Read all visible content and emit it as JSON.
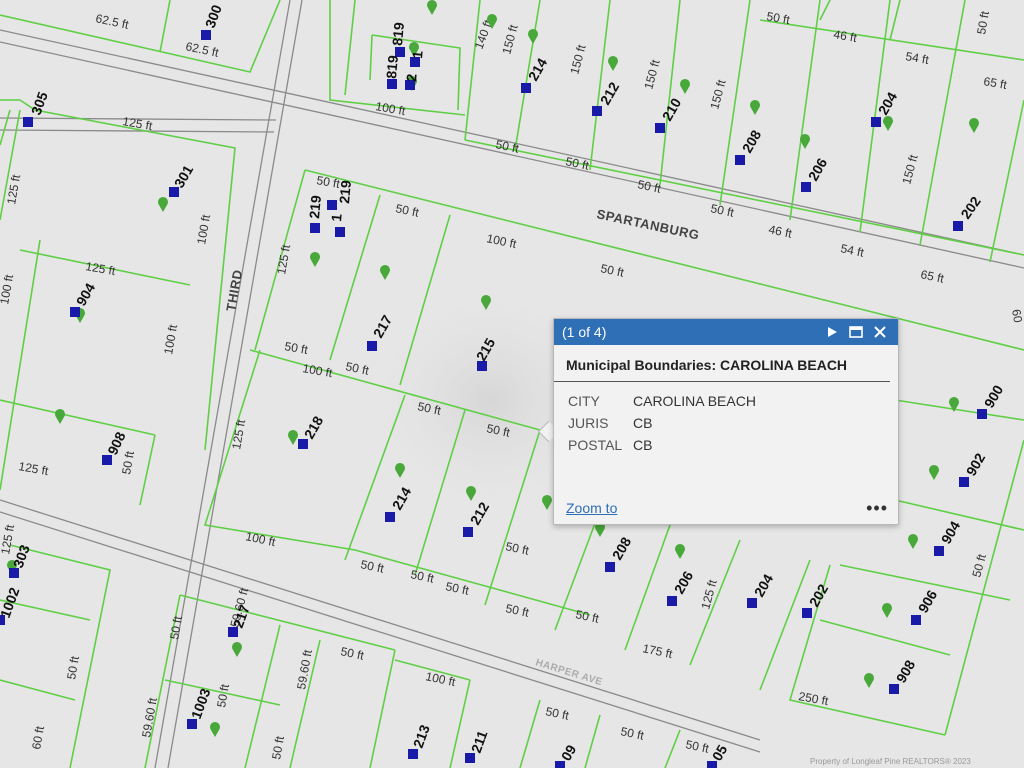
{
  "map": {
    "streets": {
      "third": "THIRD",
      "spartanburg": "SPARTANBURG",
      "bottom": "HARPER AVE"
    },
    "lot_labels": [
      {
        "t": "62.5 ft"
      },
      {
        "t": "62.5 ft"
      },
      {
        "t": "140 ft"
      },
      {
        "t": "150 ft"
      },
      {
        "t": "150 ft"
      },
      {
        "t": "150 ft"
      },
      {
        "t": "150 ft"
      },
      {
        "t": "50 ft"
      },
      {
        "t": "46 ft"
      },
      {
        "t": "54 ft"
      },
      {
        "t": "65 ft"
      },
      {
        "t": "50 ft"
      },
      {
        "t": "100 ft"
      },
      {
        "t": "50 ft"
      },
      {
        "t": "50 ft"
      },
      {
        "t": "50 ft"
      },
      {
        "t": "50 ft"
      },
      {
        "t": "46 ft"
      },
      {
        "t": "54 ft"
      },
      {
        "t": "65 ft"
      },
      {
        "t": "150 ft"
      },
      {
        "t": "125 ft"
      },
      {
        "t": "125 ft"
      },
      {
        "t": "100 ft"
      },
      {
        "t": "125 ft"
      },
      {
        "t": "100 ft"
      },
      {
        "t": "100 ft"
      },
      {
        "t": "125 ft"
      },
      {
        "t": "50 ft"
      },
      {
        "t": "125 ft"
      },
      {
        "t": "50 ft"
      },
      {
        "t": "100 ft"
      },
      {
        "t": "50 ft"
      },
      {
        "t": "50 ft"
      },
      {
        "t": "100 ft"
      },
      {
        "t": "50 ft"
      },
      {
        "t": "50 ft"
      },
      {
        "t": "50 ft"
      },
      {
        "t": "50 ft"
      },
      {
        "t": "50 ft"
      },
      {
        "t": "125 ft"
      },
      {
        "t": "125 ft"
      },
      {
        "t": "100 ft"
      },
      {
        "t": "50 ft"
      },
      {
        "t": "50 ft"
      },
      {
        "t": "50 ft"
      },
      {
        "t": "125 ft"
      },
      {
        "t": "50 ft"
      },
      {
        "t": "50 ft"
      },
      {
        "t": "250 ft"
      },
      {
        "t": "175 ft"
      },
      {
        "t": "50 ft"
      },
      {
        "t": "50 ft"
      },
      {
        "t": "59.60 ft"
      },
      {
        "t": "59.60 ft"
      },
      {
        "t": "59.60 ft"
      },
      {
        "t": "50 ft"
      },
      {
        "t": "100 ft"
      },
      {
        "t": "50 ft"
      },
      {
        "t": "50 ft"
      },
      {
        "t": "50 ft"
      },
      {
        "t": "50 ft"
      },
      {
        "t": "60 ft"
      },
      {
        "t": "50 ft"
      },
      {
        "t": "50 ft"
      },
      {
        "t": "60"
      }
    ],
    "addresses": [
      {
        "t": "300"
      },
      {
        "t": "305"
      },
      {
        "t": "301"
      },
      {
        "t": "904"
      },
      {
        "t": "908"
      },
      {
        "t": "303"
      },
      {
        "t": "1002"
      },
      {
        "t": "1003"
      },
      {
        "t": "217"
      },
      {
        "t": "213"
      },
      {
        "t": "211"
      },
      {
        "t": "819"
      },
      {
        "t": "819"
      },
      {
        "t": "1"
      },
      {
        "t": "2"
      },
      {
        "t": "214"
      },
      {
        "t": "212"
      },
      {
        "t": "210"
      },
      {
        "t": "208"
      },
      {
        "t": "206"
      },
      {
        "t": "204"
      },
      {
        "t": "202"
      },
      {
        "t": "219"
      },
      {
        "t": "219"
      },
      {
        "t": "1"
      },
      {
        "t": "217"
      },
      {
        "t": "215"
      },
      {
        "t": "218"
      },
      {
        "t": "214"
      },
      {
        "t": "212"
      },
      {
        "t": "208"
      },
      {
        "t": "206"
      },
      {
        "t": "204"
      },
      {
        "t": "202"
      },
      {
        "t": "900"
      },
      {
        "t": "902"
      },
      {
        "t": "904"
      },
      {
        "t": "906"
      },
      {
        "t": "908"
      },
      {
        "t": "09"
      },
      {
        "t": "05"
      }
    ],
    "watermark": "Property of Longleaf Pine REALTORS® 2023",
    "colors": {
      "background": "#e6e6e6",
      "parcel_line": "#5fcf45",
      "street_line": "#8a8a8a",
      "address_marker": "#1a1aa8",
      "pin": "#48a83a"
    }
  },
  "popup": {
    "counter": "(1 of 4)",
    "title": "Municipal Boundaries: CAROLINA BEACH",
    "attributes": [
      {
        "key": "CITY",
        "value": "CAROLINA BEACH"
      },
      {
        "key": "JURIS",
        "value": "CB"
      },
      {
        "key": "POSTAL",
        "value": "CB"
      }
    ],
    "zoom_label": "Zoom to",
    "more_label": "•••",
    "header_color": "#2e6fb5"
  }
}
